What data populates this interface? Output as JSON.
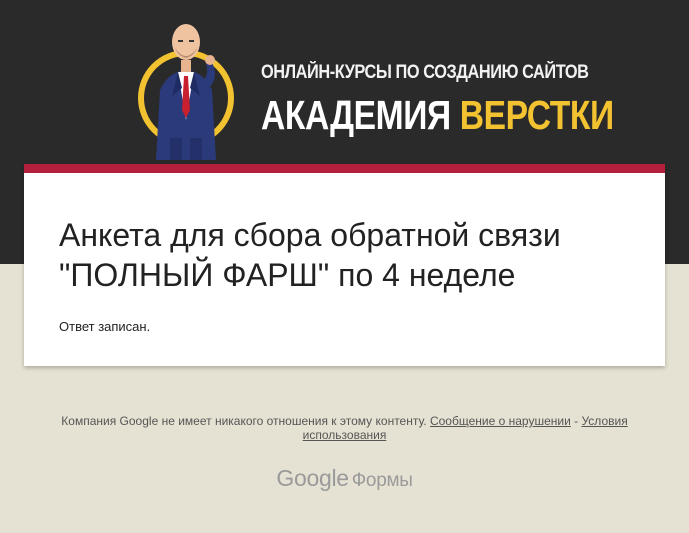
{
  "header": {
    "subtitle": "ОНЛАЙН-КУРСЫ ПО СОЗДАНИЮ САЙТОВ",
    "title_part1": "АКАДЕМИЯ ",
    "title_part2": "ВЕРСТКИ"
  },
  "form": {
    "title": "Анкета для сбора обратной связи\n\"ПОЛНЫЙ ФАРШ\" по 4 неделе",
    "response_message": "Ответ записан."
  },
  "footer": {
    "disclaimer": "Компания Google не имеет никакого отношения к этому контенту.",
    "report_link": "Сообщение о нарушении",
    "separator": "-",
    "terms_link_part1": "Условия",
    "terms_link_part2": "использования",
    "brand_google": "Google",
    "brand_forms": "Формы"
  },
  "colors": {
    "header_bg": "#2a2a2a",
    "page_bg": "#e6e2d3",
    "accent_bar": "#b41f3b",
    "brand_yellow": "#f2c230"
  }
}
